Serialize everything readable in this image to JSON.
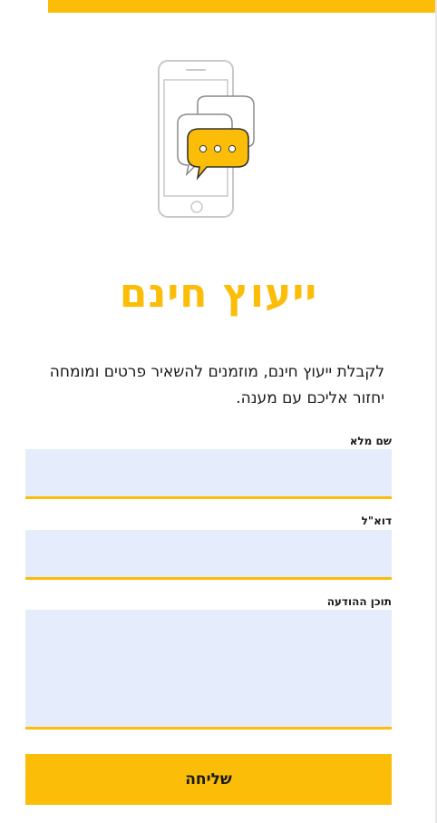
{
  "page": {
    "title": "ייעוץ חינם",
    "intro": "לקבלת ייעוץ חינם, מוזמנים להשאיר פרטים ומומחה יחזור אליכם עם מענה."
  },
  "illustration": {
    "icon": "phone-chat-icon",
    "accent_color": "#fbbd08"
  },
  "form": {
    "fields": [
      {
        "label": "שם מלא",
        "value": "",
        "placeholder": ""
      },
      {
        "label": "דוא\"ל",
        "value": "",
        "placeholder": ""
      },
      {
        "label": "תוכן ההודעה",
        "value": "",
        "placeholder": ""
      }
    ],
    "submit_label": "שליחה"
  },
  "colors": {
    "accent": "#fbbd08",
    "field_background": "#e5edfd",
    "text": "#1a1a1a"
  }
}
